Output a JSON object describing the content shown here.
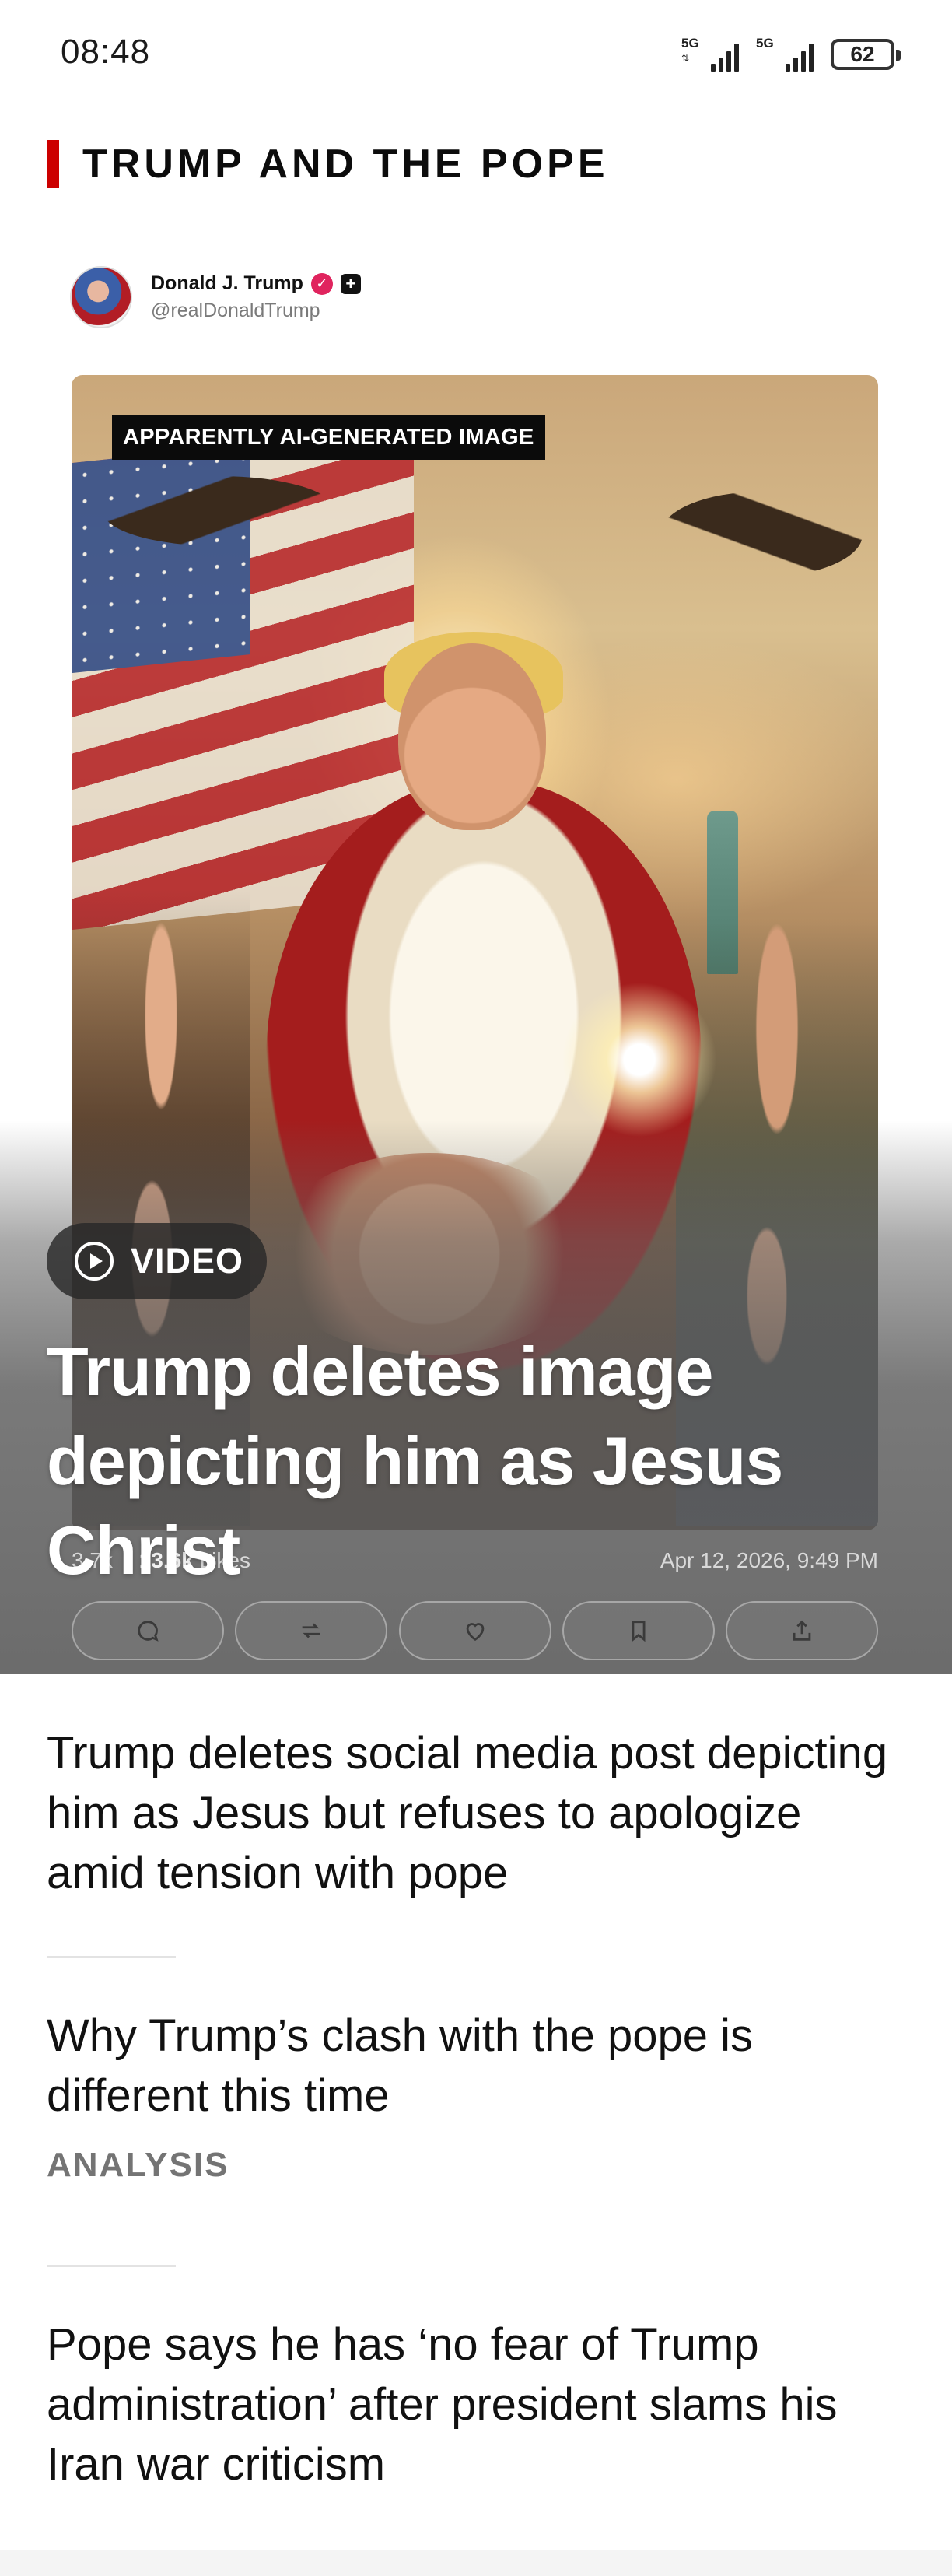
{
  "status_bar": {
    "time": "08:48",
    "signal_1": "5G",
    "signal_2": "5G",
    "battery": "62"
  },
  "section": {
    "title": "TRUMP AND THE POPE",
    "accent_color": "#cc0000"
  },
  "hero": {
    "tweet": {
      "author_name": "Donald J. Trump",
      "author_handle": "@realDonaldTrump",
      "image_label": "APPARENTLY AI-GENERATED IMAGE",
      "likes_count": "13.6k",
      "likes_label": "Likes",
      "partial_stat": "3.7k",
      "timestamp": "Apr 12, 2026, 9:49 PM",
      "actions": [
        "reply-icon",
        "repost-icon",
        "like-icon",
        "bookmark-icon",
        "share-icon"
      ]
    },
    "badge_label": "VIDEO",
    "headline": "Trump deletes image depicting him as Jesus Christ"
  },
  "articles": [
    {
      "headline": "Trump deletes social media post depicting him as Jesus but refuses to apologize amid tension with pope"
    },
    {
      "headline": "Why Trump’s clash with the pope is different this time",
      "label": "ANALYSIS"
    },
    {
      "headline": "Pope says he has ‘no fear of Trump administration’ after president slams his Iran war criticism"
    }
  ]
}
